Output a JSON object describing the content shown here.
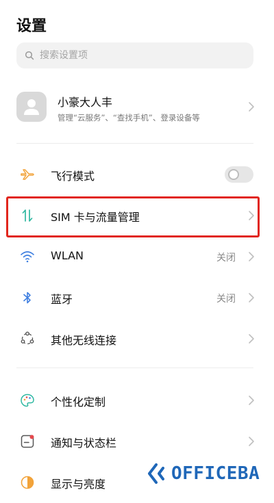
{
  "header": {
    "title": "设置"
  },
  "search": {
    "placeholder": "搜索设置项"
  },
  "account": {
    "name": "小豪大人丰",
    "subtitle": "管理“云服务”、“查找手机”、登录设备等"
  },
  "rows": [
    {
      "label": "飞行模式",
      "icon": "airplane-icon",
      "toggle": false
    },
    {
      "label": "SIM 卡与流量管理",
      "icon": "sim-data-icon",
      "highlighted": true
    },
    {
      "label": "WLAN",
      "icon": "wifi-icon",
      "value": "关闭"
    },
    {
      "label": "蓝牙",
      "icon": "bluetooth-icon",
      "value": "关闭"
    },
    {
      "label": "其他无线连接",
      "icon": "wireless-connections-icon"
    },
    {
      "label": "个性化定制",
      "icon": "palette-icon"
    },
    {
      "label": "通知与状态栏",
      "icon": "notification-icon"
    },
    {
      "label": "显示与亮度",
      "icon": "display-brightness-icon"
    }
  ],
  "watermark": {
    "text": "OFFICEBA"
  },
  "colors": {
    "accent_orange": "#f2a33a",
    "accent_green": "#2eb8a0",
    "accent_blue": "#3f7fe0",
    "accent_red": "#e5484d",
    "highlight_border": "#e1261c",
    "watermark_blue": "#1f67b8"
  }
}
